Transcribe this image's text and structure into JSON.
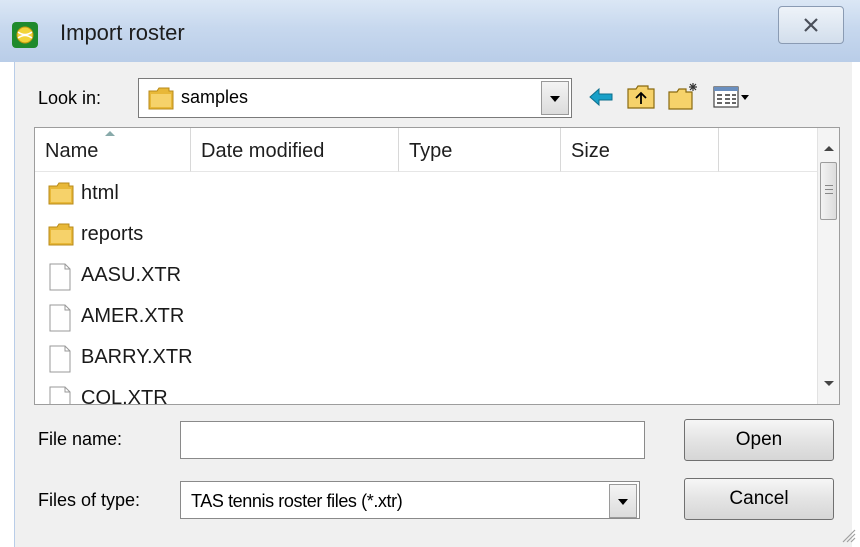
{
  "window": {
    "title": "Import roster",
    "app_icon": "tennis-ball-icon",
    "close_icon": "close-icon"
  },
  "lookin": {
    "label": "Look in:",
    "value": "samples",
    "folder_icon": "folder-icon",
    "toolbar_icons": [
      "back-arrow-icon",
      "up-folder-icon",
      "new-folder-icon",
      "view-menu-icon"
    ]
  },
  "filelist": {
    "columns": [
      "Name",
      "Date modified",
      "Type",
      "Size"
    ],
    "sorted_by": "Name",
    "items": [
      {
        "name": "html",
        "kind": "folder"
      },
      {
        "name": "reports",
        "kind": "folder"
      },
      {
        "name": "AASU.XTR",
        "kind": "file"
      },
      {
        "name": "AMER.XTR",
        "kind": "file"
      },
      {
        "name": "BARRY.XTR",
        "kind": "file"
      },
      {
        "name": "COL.XTR",
        "kind": "file"
      }
    ]
  },
  "form": {
    "filename_label": "File name:",
    "filename_value": "",
    "filetype_label": "Files of type:",
    "filetype_value": "TAS tennis roster files (*.xtr)"
  },
  "buttons": {
    "open": "Open",
    "cancel": "Cancel"
  },
  "colors": {
    "titlebar": "#c7d8ee",
    "folder": "#e8b838",
    "back_arrow": "#19a0c8",
    "app_icon_bg": "#1f8a2c"
  }
}
